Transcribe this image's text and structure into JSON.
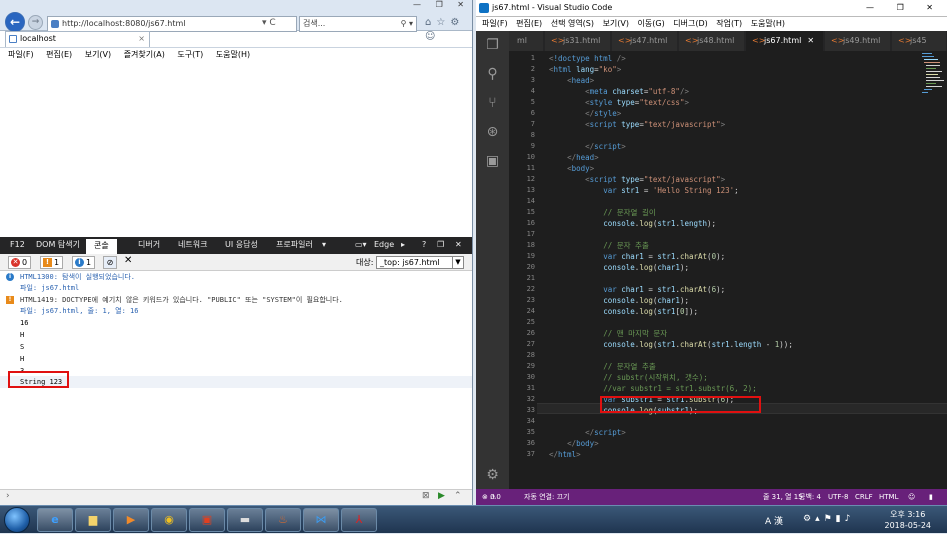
{
  "ie": {
    "url": "http://localhost:8080/js67.html",
    "url_tools": "▾ C",
    "search_placeholder": "검색...",
    "search_icon": "⚲ ▾",
    "tab_title": "localhost",
    "tab_close": "×",
    "menu": [
      "파일(F)",
      "편집(E)",
      "보기(V)",
      "즐겨찾기(A)",
      "도구(T)",
      "도움말(H)"
    ],
    "window_controls": "— ❐ ✕"
  },
  "f12": {
    "tabs": {
      "f12": "F12",
      "dom": "DOM 탐색기",
      "console": "콘솔",
      "debugger": "디버거",
      "network": "네트워크",
      "ui": "UI 응답성",
      "profiler": "프로파일러",
      "edge": "Edge"
    },
    "counts": {
      "errors": "0",
      "warnings": "1",
      "info": "1"
    },
    "target_label": "대상:",
    "target_value": "_top: js67.html",
    "console_lines": [
      {
        "text": "HTML1300: 탐색이 실행되었습니다.",
        "type": "info"
      },
      {
        "text": "파일: js67.html",
        "type": "link"
      },
      {
        "text": "HTML1419: DOCTYPE에 예기치 않은 키워드가 있습니다. \"PUBLIC\" 또는 \"SYSTEM\"이 필요합니다.",
        "type": "warn"
      },
      {
        "text": "파일: js67.html, 줄: 1, 열: 16",
        "type": "link"
      },
      {
        "text": "16",
        "type": "plain"
      },
      {
        "text": "H",
        "type": "plain"
      },
      {
        "text": "S",
        "type": "plain"
      },
      {
        "text": "H",
        "type": "plain"
      },
      {
        "text": "3",
        "type": "plain"
      },
      {
        "text": "String 123",
        "type": "plain"
      }
    ]
  },
  "vscode": {
    "title": "js67.html - Visual Studio Code",
    "window_controls": "— ❐ ✕",
    "menu": [
      "파일(F)",
      "편집(E)",
      "선택 영역(S)",
      "보기(V)",
      "이동(G)",
      "디버그(D)",
      "작업(T)",
      "도움말(H)"
    ],
    "tabs": [
      "ml",
      "js31.html",
      "js47.html",
      "js48.html",
      "js67.html",
      "js49.html",
      "js45"
    ],
    "active_tab": "js67.html",
    "line_numbers": [
      "1",
      "2",
      "3",
      "4",
      "5",
      "6",
      "7",
      "8",
      "9",
      "10",
      "11",
      "12",
      "13",
      "14",
      "15",
      "16",
      "17",
      "18",
      "19",
      "20",
      "21",
      "22",
      "23",
      "24",
      "25",
      "26",
      "27",
      "28",
      "29",
      "30",
      "31",
      "32",
      "33",
      "34",
      "35",
      "36",
      "37"
    ],
    "status": {
      "errors": "0",
      "warnings": "0",
      "autoconnect": "자동 연결: 끄기",
      "position": "줄 31, 열 15",
      "spaces": "공백: 4",
      "encoding": "UTF-8",
      "eol": "CRLF",
      "language": "HTML"
    }
  },
  "taskbar": {
    "ime": "A 漢",
    "time": "오후 3:16",
    "date": "2018-05-24"
  }
}
